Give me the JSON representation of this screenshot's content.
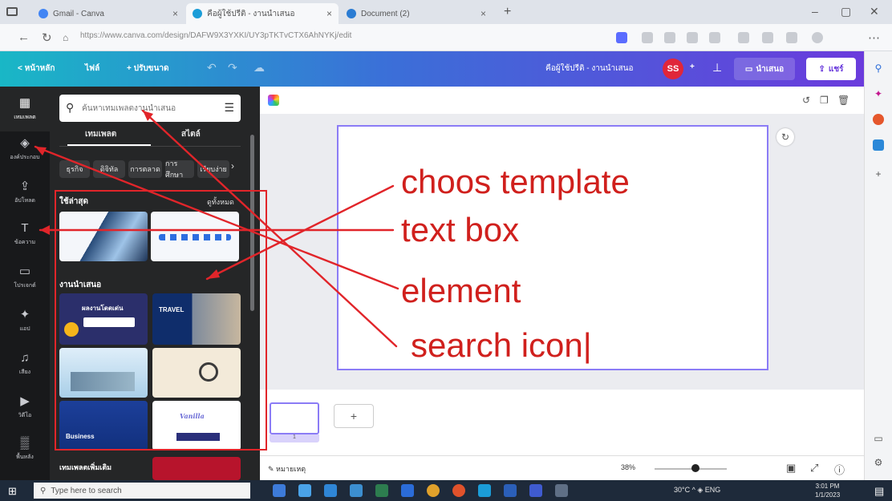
{
  "browser": {
    "tabs": [
      {
        "label": "Gmail - Canva"
      },
      {
        "label": "คือผู้ใช้ปรีติ - งานนำเสนอ"
      },
      {
        "label": "Document (2)"
      }
    ],
    "new_tab_label": "+",
    "url": "https://www.canva.com/design/DAFW9X3YXKI/UY3pTKTvCTX6AhNYKj/edit",
    "window_controls": [
      "–",
      "▢",
      "✕"
    ]
  },
  "header": {
    "home": "< หน้าหลัก",
    "file": "ไฟล์",
    "resize": "+ ปรับขนาด",
    "title": "คือผู้ใช้ปรีติ - งานนำเสนอ",
    "avatar_initials": "SS",
    "present_label": "นำเสนอ",
    "share_label": "แชร์"
  },
  "rail": {
    "items": [
      {
        "label": "เทมเพลต",
        "icon": "▦"
      },
      {
        "label": "องค์ประกอบ",
        "icon": "◈"
      },
      {
        "label": "อัปโหลด",
        "icon": "⇪"
      },
      {
        "label": "ข้อความ",
        "icon": "T"
      },
      {
        "label": "โปรเจกต์",
        "icon": "▭"
      },
      {
        "label": "แอป",
        "icon": "✦"
      },
      {
        "label": "เสียง",
        "icon": "♫"
      },
      {
        "label": "วิดีโอ",
        "icon": "▶"
      },
      {
        "label": "พื้นหลัง",
        "icon": "▒"
      }
    ]
  },
  "panel": {
    "search_placeholder": "ค้นหาเทมเพลตงานนำเสนอ",
    "tabs": [
      "เทมเพลต",
      "สไตล์"
    ],
    "chips": [
      "ธุรกิจ",
      "ดิจิทัล",
      "การตลาด",
      "การศึกษา",
      "เรียบง่าย"
    ],
    "recent_title": "ใช้ล่าสุด",
    "recent_link": "ดูทั้งหมด",
    "templates_title": "งานนำเสนอ",
    "template_texts": [
      "ผลงานโดดเด่น",
      "TRAVEL",
      "Vanilla",
      "Business"
    ],
    "more_section": "เทมเพลตเพิ่มเติม"
  },
  "editor": {
    "page_number": "1",
    "add_page": "+",
    "notes_label": "หมายเหตุ",
    "zoom_label": "38%",
    "rotate_icon": "↻"
  },
  "annotations": {
    "choose_template": "choos template",
    "text_box": "text box",
    "element": "element",
    "search_icon": "search icon|"
  },
  "taskbar": {
    "search_placeholder": "Type here to search",
    "tray_text": "30°C  ^  ◈  ENG",
    "time": "3:01 PM",
    "date": "1/1/2023"
  },
  "colors": {
    "annotation_red": "#d0201d",
    "canva_purple": "#6a3bdc",
    "canva_teal": "#19b7c6",
    "panel_dark": "#252627",
    "rail_dark": "#18191b"
  }
}
